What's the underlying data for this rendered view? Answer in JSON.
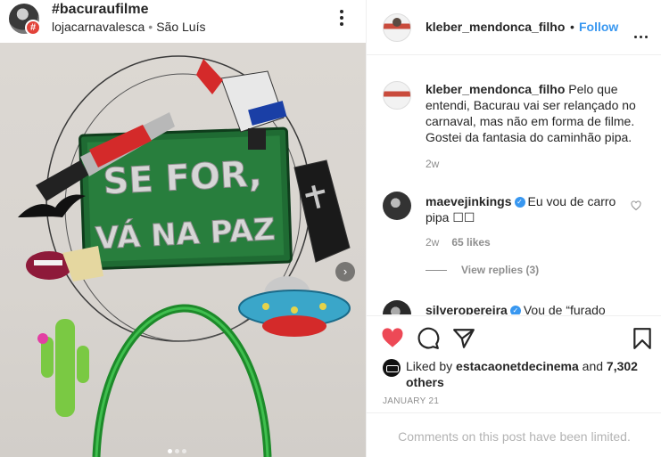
{
  "left": {
    "hashtag": "#bacuraufilme",
    "account": "lojacarnavalesca",
    "separator": "•",
    "location": "São Luís",
    "badge": "#",
    "photo_text_line1": "SE FOR,",
    "photo_text_line2": "VÁ NA PAZ",
    "next_glyph": "›"
  },
  "post": {
    "owner": "kleber_mendonca_filho",
    "follow_dot": "•",
    "follow_label": "Follow",
    "accent": "#3897f0",
    "caption_user": "kleber_mendonca_filho",
    "caption_text": "Pelo que entendi, Bacurau vai ser relançado no carnaval, mas não em forma de filme. Gostei da fantasia do caminhão pipa.",
    "caption_time": "2w",
    "comments": [
      {
        "user": "maevejinkings",
        "verified": true,
        "text": "Eu vou de carro pipa ☐☐",
        "time": "2w",
        "likes": "65 likes",
        "view_replies": "View replies (3)"
      },
      {
        "user": "silveropereira",
        "verified": true,
        "text": "Vou de “furado"
      }
    ],
    "liked_by_prefix": "Liked by",
    "liked_by_user": "estacaonetdecinema",
    "liked_by_and": "and",
    "likes_count": "7,302 others",
    "date": "JANUARY 21",
    "comments_limited": "Comments on this post have been limited.",
    "like_color": "#ed4956"
  },
  "icons": {
    "like": "heart-icon",
    "comment": "comment-icon",
    "share": "send-icon",
    "save": "bookmark-icon",
    "more": "more-icon"
  }
}
